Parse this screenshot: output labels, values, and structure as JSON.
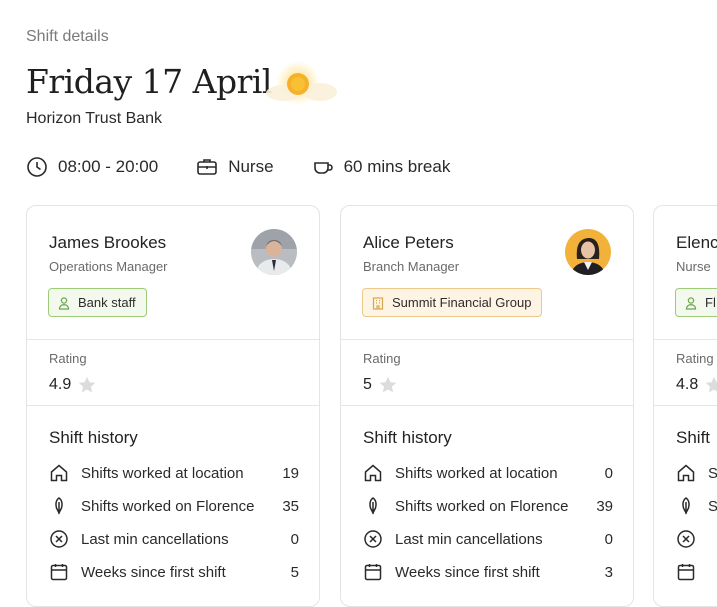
{
  "page": {
    "breadcrumb": "Shift details",
    "title": "Friday 17 April",
    "subtitle": "Horizon Trust Bank",
    "weather_icon": "sun-behind-cloud-icon"
  },
  "shift_meta": {
    "time": "08:00 - 20:00",
    "role": "Nurse",
    "break": "60 mins break"
  },
  "cards": [
    {
      "name": "James Brookes",
      "role": "Operations Manager",
      "badge": "Bank staff",
      "badge_icon": "person-icon",
      "badge_color": "#9ccc78",
      "rating_label": "Rating",
      "rating": "4.9",
      "history_title": "Shift history",
      "history": [
        {
          "label": "Shifts worked at location",
          "value": "19"
        },
        {
          "label": "Shifts worked on Florence",
          "value": "35"
        },
        {
          "label": "Last min cancellations",
          "value": "0"
        },
        {
          "label": "Weeks since first shift",
          "value": "5"
        }
      ]
    },
    {
      "name": "Alice Peters",
      "role": "Branch Manager",
      "badge": "Summit Financial Group",
      "badge_icon": "building-icon",
      "badge_color": "#ecc98a",
      "rating_label": "Rating",
      "rating": "5",
      "history_title": "Shift history",
      "history": [
        {
          "label": "Shifts worked at location",
          "value": "0"
        },
        {
          "label": "Shifts worked on Florence",
          "value": "39"
        },
        {
          "label": "Last min cancellations",
          "value": "0"
        },
        {
          "label": "Weeks since first shift",
          "value": "3"
        }
      ]
    },
    {
      "name": "Elenc",
      "role": "Nurse",
      "badge": "Fl",
      "badge_icon": "person-icon",
      "badge_color": "#9ccc78",
      "rating_label": "Rating",
      "rating": "4.8",
      "history_title": "Shift",
      "history": [
        {
          "label": "S",
          "value": ""
        },
        {
          "label": "S",
          "value": ""
        },
        {
          "label": "",
          "value": ""
        },
        {
          "label": "",
          "value": ""
        }
      ]
    }
  ]
}
